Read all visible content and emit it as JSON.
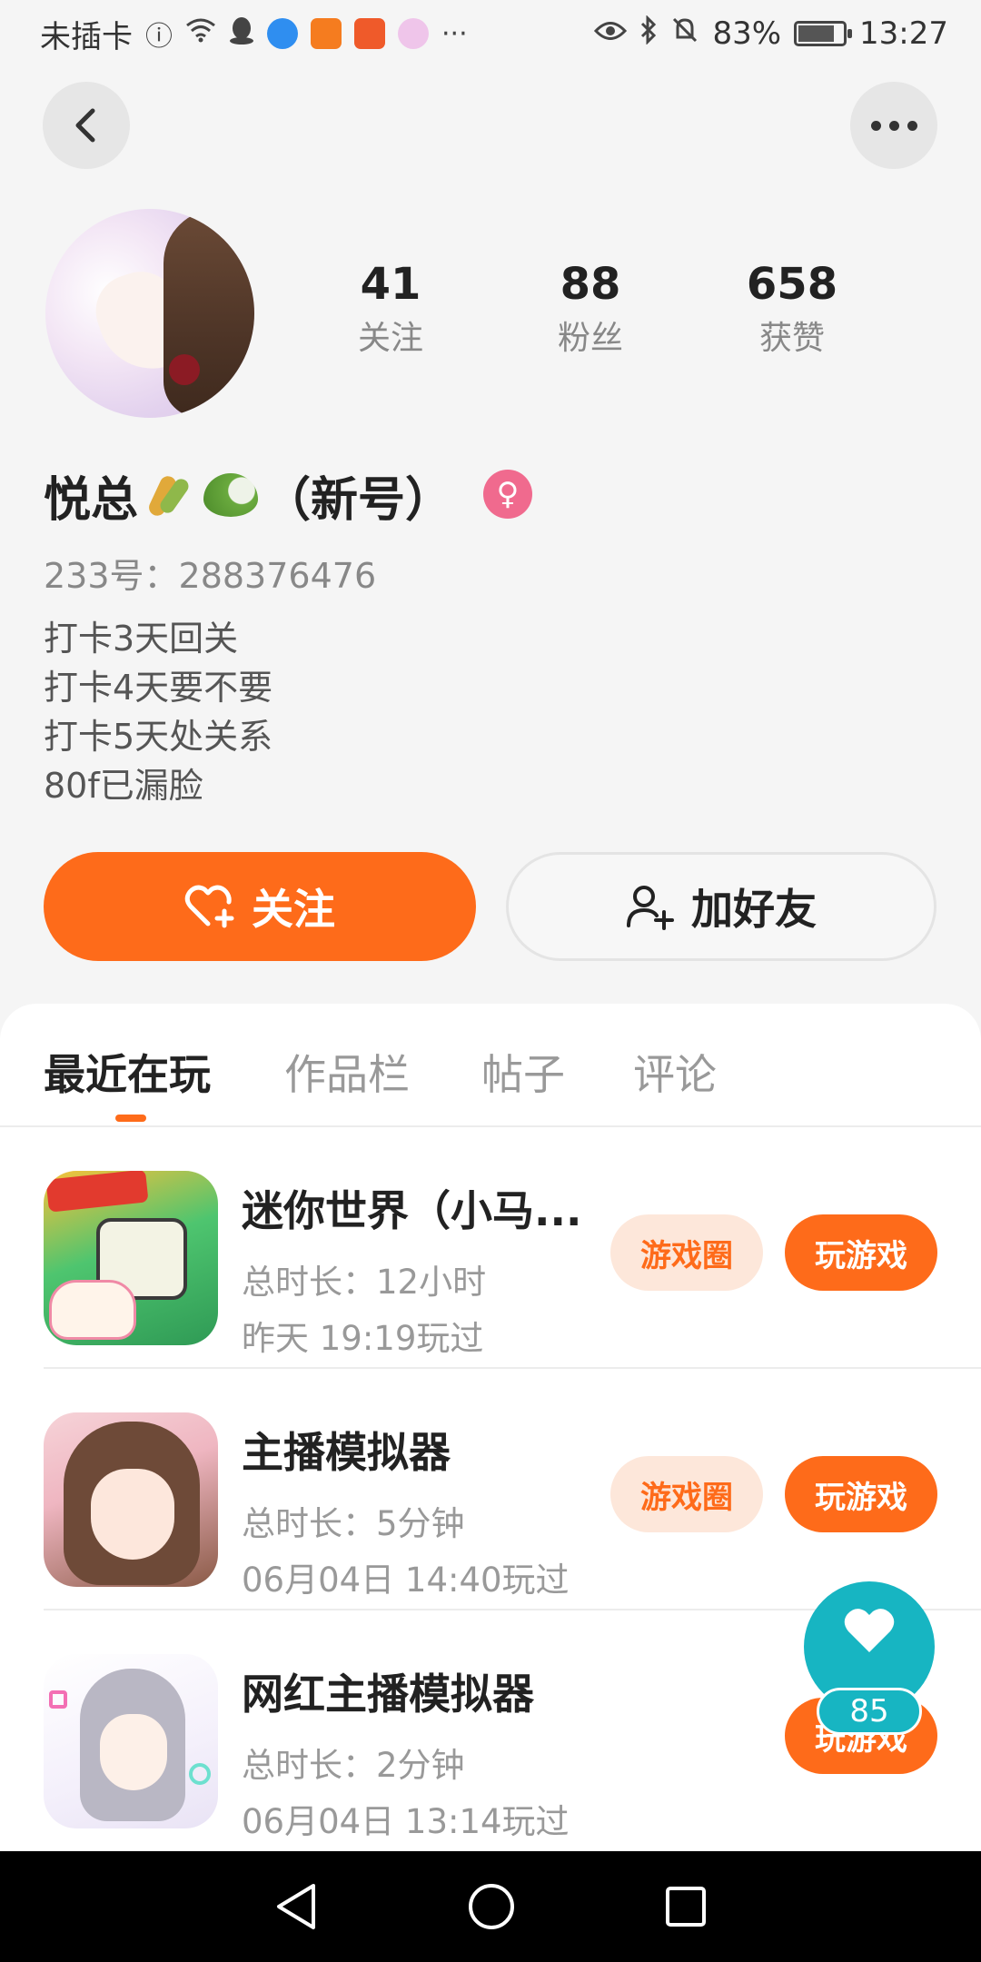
{
  "status_bar": {
    "carrier": "未插卡",
    "more": "···",
    "battery": "83%",
    "battery_level": 0.83,
    "time": "13:27"
  },
  "profile": {
    "stats": [
      {
        "value": "41",
        "label": "关注"
      },
      {
        "value": "88",
        "label": "粉丝"
      },
      {
        "value": "658",
        "label": "获赞"
      }
    ],
    "name_prefix": "悦总",
    "name_suffix": "（新号）",
    "gender_symbol": "♀",
    "uid": "233号：288376476",
    "bio": [
      "打卡3天回关",
      "打卡4天要不要",
      "打卡5天处关系",
      "80f已漏脸"
    ]
  },
  "actions": {
    "follow_label": "关注",
    "add_friend_label": "加好友"
  },
  "tabs": [
    {
      "label": "最近在玩",
      "active": true
    },
    {
      "label": "作品栏",
      "active": false
    },
    {
      "label": "帖子",
      "active": false
    },
    {
      "label": "评论",
      "active": false
    }
  ],
  "games": [
    {
      "title": "迷你世界（小马...",
      "duration": "总时长：12小时",
      "last_played": "昨天 19:19玩过",
      "circle_label": "游戏圈",
      "play_label": "玩游戏"
    },
    {
      "title": "主播模拟器",
      "duration": "总时长：5分钟",
      "last_played": "06月04日 14:40玩过",
      "circle_label": "游戏圈",
      "play_label": "玩游戏"
    },
    {
      "title": "网红主播模拟器",
      "duration": "总时长：2分钟",
      "last_played": "06月04日 13:14玩过",
      "play_label": "玩游戏"
    }
  ],
  "floating_like": {
    "count": "85"
  },
  "colors": {
    "accent": "#fe6b1a",
    "teal": "#17b5c2",
    "gender_badge": "#f06a8e"
  }
}
